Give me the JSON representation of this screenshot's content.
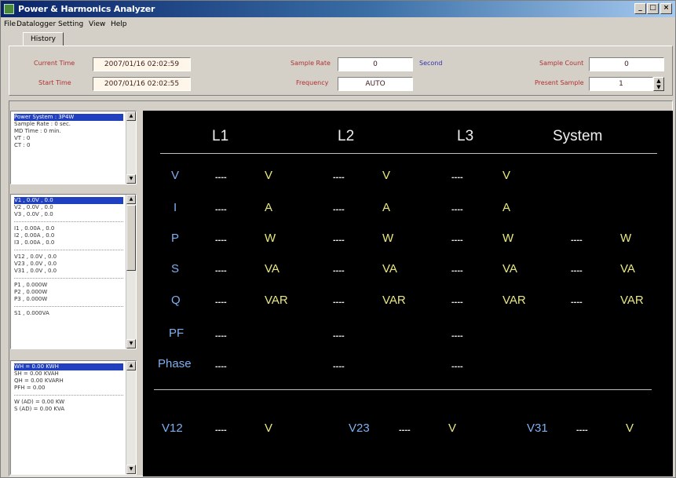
{
  "window": {
    "title": "Power & Harmonics Analyzer",
    "controls": [
      "_",
      "□",
      "×"
    ]
  },
  "menu": [
    "File",
    "Datalogger",
    "Setting",
    "View",
    "Help"
  ],
  "tab": "History",
  "top": {
    "current_time_label": "Current Time",
    "current_time_value": "2007/01/16 02:02:59",
    "start_time_label": "Start Time",
    "start_time_value": "2007/01/16 02:02:55",
    "sample_rate_label": "Sample Rate",
    "sample_rate_value": "0",
    "sample_rate_unit": "Second",
    "frequency_label": "Frequency",
    "frequency_value": "AUTO",
    "sample_count_label": "Sample Count",
    "sample_count_value": "0",
    "present_sample_label": "Present Sample",
    "present_sample_value": "1"
  },
  "list1": {
    "rows": [
      "Power System : 3P4W",
      "Sample Rate : 0 sec.",
      "MD Time : 0 min.",
      "VT : 0",
      "CT : 0"
    ]
  },
  "list2": {
    "rows": [
      "V1 , 0.0V , 0.0",
      "V2 , 0.0V , 0.0",
      "V3 , 0.0V , 0.0",
      "I1 , 0.00A , 0.0",
      "I2 , 0.00A , 0.0",
      "I3 , 0.00A , 0.0",
      "V12 , 0.0V , 0.0",
      "V23 , 0.0V , 0.0",
      "V31 , 0.0V , 0.0",
      "P1 , 0.000W",
      "P2 , 0.000W",
      "P3 , 0.000W",
      "S1 , 0.000VA"
    ]
  },
  "list3": {
    "rows": [
      "WH = 0.00 KWH",
      "SH = 0.00 KVAH",
      "QH = 0.00 KVARH",
      "PFH = 0.00",
      "W (AD) = 0.00 KW",
      "S (AD) = 0.00 KVA"
    ]
  },
  "display": {
    "headers": {
      "l1": "L1",
      "l2": "L2",
      "l3": "L3",
      "system": "System"
    },
    "quantities": {
      "v": "V",
      "i": "I",
      "p": "P",
      "s": "S",
      "q": "Q",
      "pf": "PF",
      "phase": "Phase"
    },
    "dash": "----",
    "units": {
      "v": "V",
      "i": "A",
      "p": "W",
      "s": "VA",
      "q": "VAR"
    },
    "line_labels": {
      "v12": "V12",
      "v23": "V23",
      "v31": "V31"
    },
    "line_unit": "V"
  },
  "colors": {
    "display_bg": "#000000",
    "quantity_label": "#7fb0f0",
    "unit": "#e8e880",
    "value": "#e8e8e8",
    "field_label": "#b03030",
    "titlebar": "#0a246a"
  }
}
